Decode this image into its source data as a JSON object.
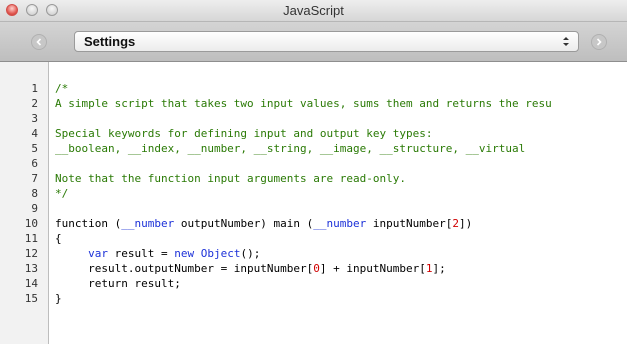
{
  "window": {
    "title": "JavaScript"
  },
  "toolbar": {
    "selected": "Settings",
    "back_icon": "chevron-left-icon",
    "forward_icon": "chevron-right-icon"
  },
  "colors": {
    "comment": "#2a7a05",
    "keyword": "#1c31d8",
    "number": "#d00000"
  },
  "editor": {
    "lines": [
      {
        "n": "1",
        "tokens": [
          {
            "t": "/*",
            "c": "cm"
          }
        ]
      },
      {
        "n": "2",
        "tokens": [
          {
            "t": "A simple script that takes two input values, sums them and returns the resu",
            "c": "cm"
          }
        ]
      },
      {
        "n": "3",
        "tokens": []
      },
      {
        "n": "4",
        "tokens": [
          {
            "t": "Special keywords for defining input and output key types:",
            "c": "cm"
          }
        ]
      },
      {
        "n": "5",
        "tokens": [
          {
            "t": "__boolean, __index, __number, __string, __image, __structure, __virtual",
            "c": "cm"
          }
        ]
      },
      {
        "n": "6",
        "tokens": []
      },
      {
        "n": "7",
        "tokens": [
          {
            "t": "Note that the function input arguments are read-only.",
            "c": "cm"
          }
        ]
      },
      {
        "n": "8",
        "tokens": [
          {
            "t": "*/",
            "c": "cm"
          }
        ]
      },
      {
        "n": "9",
        "tokens": []
      },
      {
        "n": "10",
        "tokens": [
          {
            "t": "function (",
            "c": ""
          },
          {
            "t": "__number",
            "c": "kw"
          },
          {
            "t": " outputNumber) main (",
            "c": ""
          },
          {
            "t": "__number",
            "c": "kw"
          },
          {
            "t": " inputNumber[",
            "c": ""
          },
          {
            "t": "2",
            "c": "num"
          },
          {
            "t": "])",
            "c": ""
          }
        ]
      },
      {
        "n": "11",
        "tokens": [
          {
            "t": "{",
            "c": ""
          }
        ]
      },
      {
        "n": "12",
        "tokens": [
          {
            "t": "     ",
            "c": ""
          },
          {
            "t": "var",
            "c": "kw"
          },
          {
            "t": " result = ",
            "c": ""
          },
          {
            "t": "new",
            "c": "kw"
          },
          {
            "t": " ",
            "c": ""
          },
          {
            "t": "Object",
            "c": "kw"
          },
          {
            "t": "();",
            "c": ""
          }
        ]
      },
      {
        "n": "13",
        "tokens": [
          {
            "t": "     result.outputNumber = inputNumber[",
            "c": ""
          },
          {
            "t": "0",
            "c": "num"
          },
          {
            "t": "] + inputNumber[",
            "c": ""
          },
          {
            "t": "1",
            "c": "num"
          },
          {
            "t": "];",
            "c": ""
          }
        ]
      },
      {
        "n": "14",
        "tokens": [
          {
            "t": "     return result;",
            "c": ""
          }
        ]
      },
      {
        "n": "15",
        "tokens": [
          {
            "t": "}",
            "c": ""
          }
        ]
      }
    ]
  }
}
